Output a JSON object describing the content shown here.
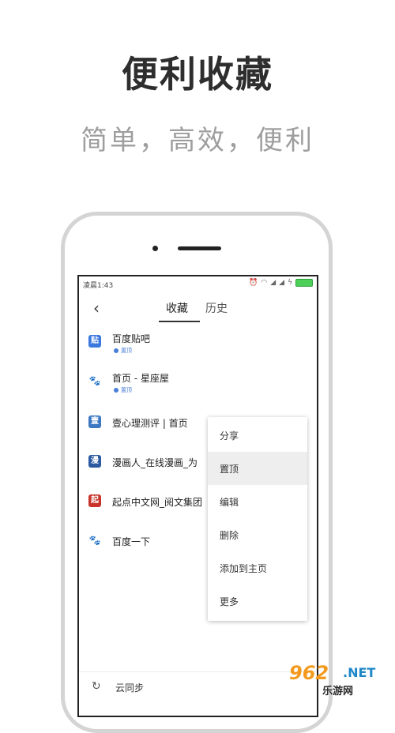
{
  "promo": {
    "title": "便利收藏",
    "subtitle": "简单，高效，便利"
  },
  "status_bar": {
    "time": "凌晨1:43",
    "icons": [
      "alarm-icon",
      "wifi-icon",
      "signal-icon",
      "signal-icon",
      "charging-icon",
      "battery-icon"
    ]
  },
  "nav": {
    "back_icon": "‹",
    "tabs": [
      {
        "label": "收藏",
        "active": true
      },
      {
        "label": "历史",
        "active": false
      }
    ]
  },
  "bookmarks": [
    {
      "title": "百度贴吧",
      "pinned": true,
      "pin_label": "置顶",
      "icon": "tieba-icon",
      "glyph": "贴",
      "color": "#3b79e0"
    },
    {
      "title": "首页 - 星座屋",
      "pinned": true,
      "pin_label": "置顶",
      "icon": "baidu-paw-icon",
      "glyph": "🐾",
      "color": "#4a7fd8"
    },
    {
      "title": "壹心理测评 | 首页",
      "pinned": false,
      "icon": "yixinli-icon",
      "glyph": "壹",
      "color": "#3a78c2"
    },
    {
      "title": "漫画人_在线漫画_为",
      "pinned": false,
      "icon": "manhuaren-icon",
      "glyph": "漫",
      "color": "#2c5aa0"
    },
    {
      "title": "起点中文网_阅文集团",
      "pinned": false,
      "icon": "qidian-icon",
      "glyph": "起",
      "color": "#c9332b"
    },
    {
      "title": "百度一下",
      "pinned": false,
      "icon": "baidu-paw-icon",
      "glyph": "🐾",
      "color": "#4a7fd8"
    }
  ],
  "context_menu": {
    "items": [
      {
        "label": "分享",
        "highlighted": false
      },
      {
        "label": "置顶",
        "highlighted": true
      },
      {
        "label": "编辑",
        "highlighted": false
      },
      {
        "label": "删除",
        "highlighted": false
      },
      {
        "label": "添加到主页",
        "highlighted": false
      },
      {
        "label": "更多",
        "highlighted": false
      }
    ]
  },
  "bottom": {
    "sync_icon": "↻",
    "sync_label": "云同步"
  },
  "watermark": {
    "number": "962",
    "suffix": ".NET",
    "name": "乐游网"
  }
}
